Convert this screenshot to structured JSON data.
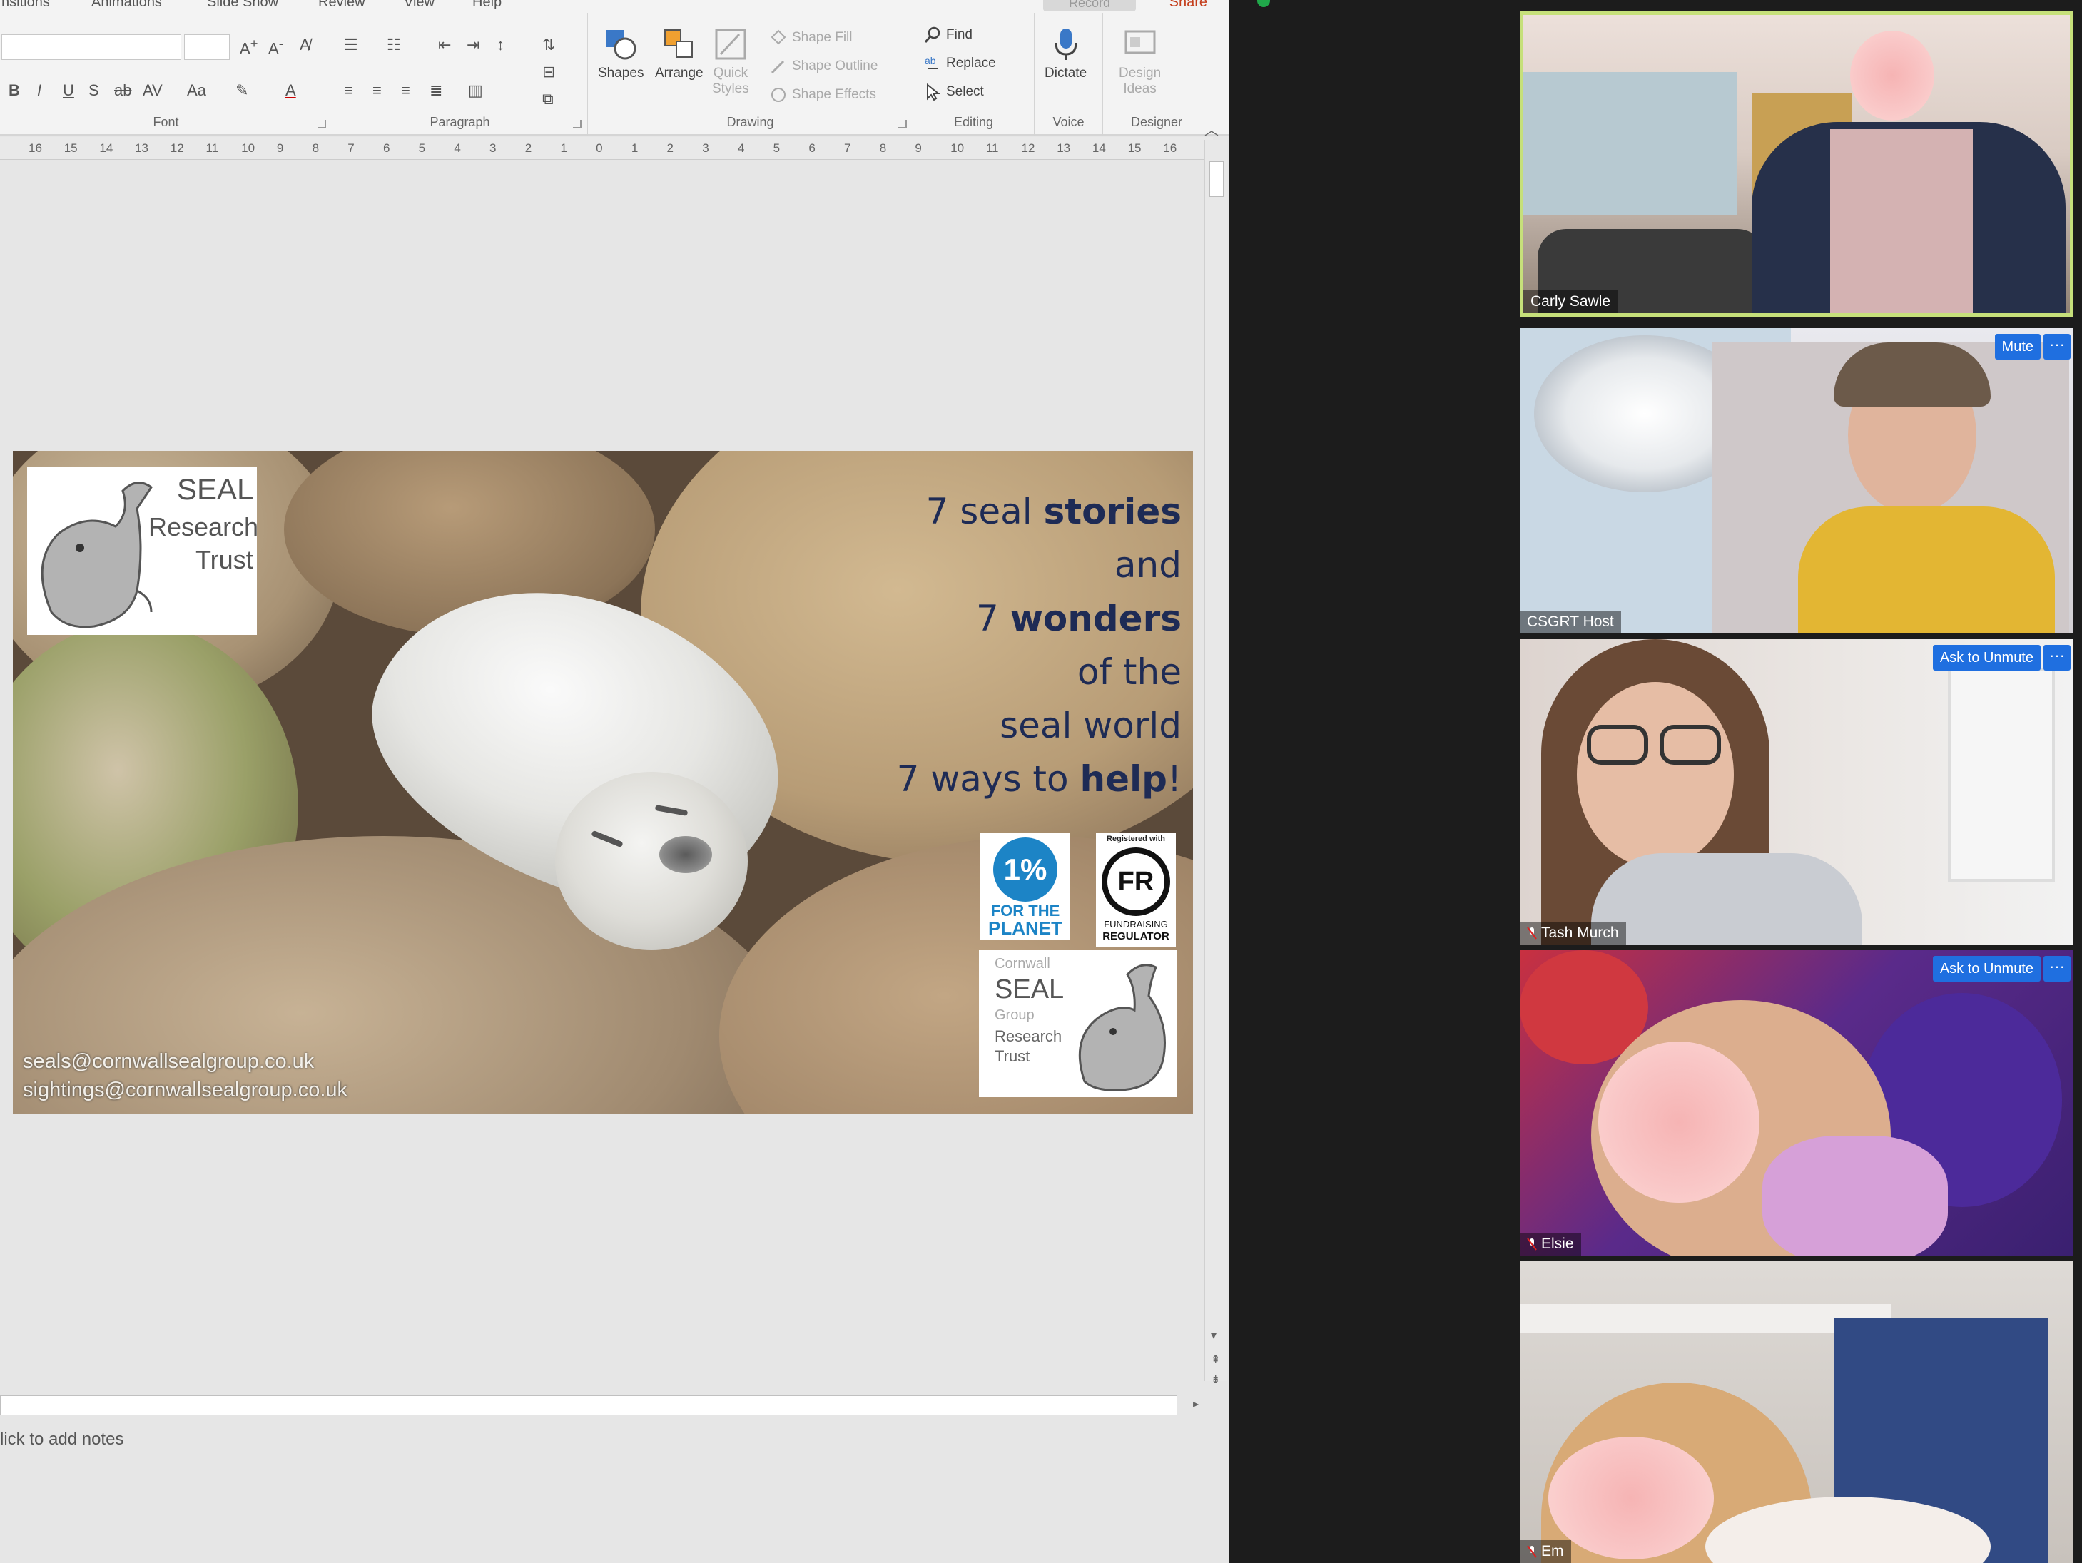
{
  "ribbon": {
    "tabs": [
      "nsitions",
      "Animations",
      "Slide Show",
      "Review",
      "View",
      "Help"
    ],
    "record_label": "Record",
    "share_label": "Share",
    "groups": {
      "font": "Font",
      "paragraph": "Paragraph",
      "drawing": "Drawing",
      "editing": "Editing",
      "voice": "Voice",
      "designer": "Designer"
    },
    "buttons": {
      "shapes": "Shapes",
      "arrange": "Arrange",
      "quick_styles_1": "Quick",
      "quick_styles_2": "Styles",
      "shape_fill": "Shape Fill",
      "shape_outline": "Shape Outline",
      "shape_effects": "Shape Effects",
      "find": "Find",
      "replace": "Replace",
      "select": "Select",
      "dictate": "Dictate",
      "design_ideas_1": "Design",
      "design_ideas_2": "Ideas"
    }
  },
  "ruler": {
    "ticks": [
      "16",
      "15",
      "14",
      "13",
      "12",
      "11",
      "10",
      "9",
      "8",
      "7",
      "6",
      "5",
      "4",
      "3",
      "2",
      "1",
      "0",
      "1",
      "2",
      "3",
      "4",
      "5",
      "6",
      "7",
      "8",
      "9",
      "10",
      "11",
      "12",
      "13",
      "14",
      "15",
      "16"
    ]
  },
  "slide": {
    "logo": {
      "line1": "SEAL",
      "line2": "Research",
      "line3": "Trust"
    },
    "tagline": {
      "l1_pre": "7 seal ",
      "l1_bold": "stories",
      "l2": "and",
      "l3_pre": "7 ",
      "l3_bold": "wonders",
      "l4": "of the",
      "l5": "seal world",
      "l6_pre": "7 ways to ",
      "l6_bold": "help",
      "l6_post": "!"
    },
    "badge_planet": {
      "pct": "1%",
      "line1": "FOR THE",
      "line2": "PLANET"
    },
    "badge_fr": {
      "top": "Registered with",
      "mark": "FR",
      "line1": "FUNDRAISING",
      "line2": "REGULATOR"
    },
    "badge_seal": {
      "l1": "Cornwall",
      "l2": "SEAL",
      "l3": "Group",
      "l4": "Research",
      "l5": "Trust"
    },
    "email1": "seals@cornwallsealgroup.co.uk",
    "email2": "sightings@cornwallsealgroup.co.uk"
  },
  "notes_placeholder": "lick to add notes",
  "participants": [
    {
      "name": "Carly Sawle",
      "active": true
    },
    {
      "name": "CSGRT Host",
      "button": "Mute"
    },
    {
      "name": "Tash Murch",
      "button": "Ask to Unmute"
    },
    {
      "name": "Elsie",
      "button": "Ask to Unmute"
    },
    {
      "name": "Em",
      "button": ""
    }
  ],
  "more_label": "···",
  "colors": {
    "tagline": "#1e2b55",
    "zoom_button": "#1f6fe0",
    "active_speaker": "#c6e07a",
    "share": "#c43e1c"
  }
}
